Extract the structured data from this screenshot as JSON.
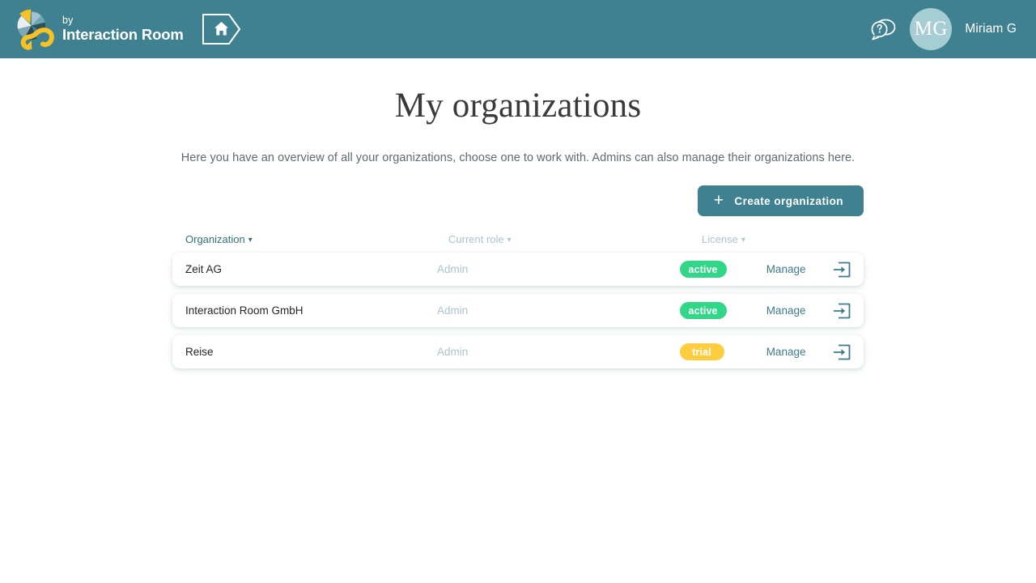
{
  "header": {
    "brand_by": "by",
    "brand_name": "Interaction Room",
    "home_icon": "home-icon",
    "help_icon": "help-question-bubble-icon",
    "avatar_initials": "MG",
    "user_name": "Miriam G",
    "bg_color": "#3f8190"
  },
  "page": {
    "title": "My organizations",
    "subtitle": "Here you have an overview of all your organizations, choose one to work with. Admins can also manage their organizations here."
  },
  "toolbar": {
    "create_label": "Create organization",
    "create_icon": "plus-icon",
    "create_color": "#3f8190"
  },
  "table": {
    "columns": [
      {
        "label": "Organization",
        "sort_icon": "chevron-down-icon"
      },
      {
        "label": "Current role",
        "sort_icon": "chevron-down-icon"
      },
      {
        "label": "License",
        "sort_icon": "chevron-down-icon"
      }
    ],
    "manage_label": "Manage",
    "enter_icon": "enter-arrow-icon",
    "rows": [
      {
        "organization": "Zeit AG",
        "role": "Admin",
        "license": "active",
        "license_type": "active",
        "manage": "Manage"
      },
      {
        "organization": "Interaction Room GmbH",
        "role": "Admin",
        "license": "active",
        "license_type": "active",
        "manage": "Manage"
      },
      {
        "organization": "Reise",
        "role": "Admin",
        "license": "trial",
        "license_type": "trial",
        "manage": "Manage"
      }
    ]
  },
  "colors": {
    "teal": "#3f8190",
    "active_badge": "#2fd787",
    "trial_badge": "#fcce3f",
    "muted_blue": "#a8c6cd"
  }
}
